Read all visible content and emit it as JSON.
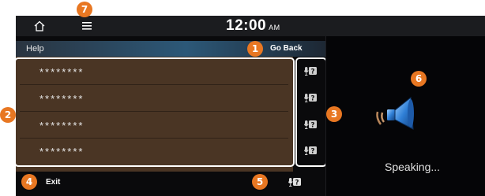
{
  "status_bar": {
    "time": "12:00",
    "ampm": "AM"
  },
  "help_bar": {
    "title": "Help",
    "go_back_label": "Go Back"
  },
  "list": {
    "items": [
      {
        "label": "********"
      },
      {
        "label": "********"
      },
      {
        "label": "********"
      },
      {
        "label": "********"
      }
    ]
  },
  "bottom": {
    "exit_label": "Exit"
  },
  "voice_panel": {
    "status": "Speaking..."
  },
  "callouts": [
    "1",
    "2",
    "3",
    "4",
    "5",
    "6",
    "7"
  ],
  "icons": {
    "home": "home-icon",
    "menu": "menu-icon",
    "voice_help": "voice-help-icon",
    "speaker": "speaker-icon"
  },
  "colors": {
    "accent": "#e87722",
    "list_background": "#4a3524",
    "help_bar": "#2c5878"
  }
}
